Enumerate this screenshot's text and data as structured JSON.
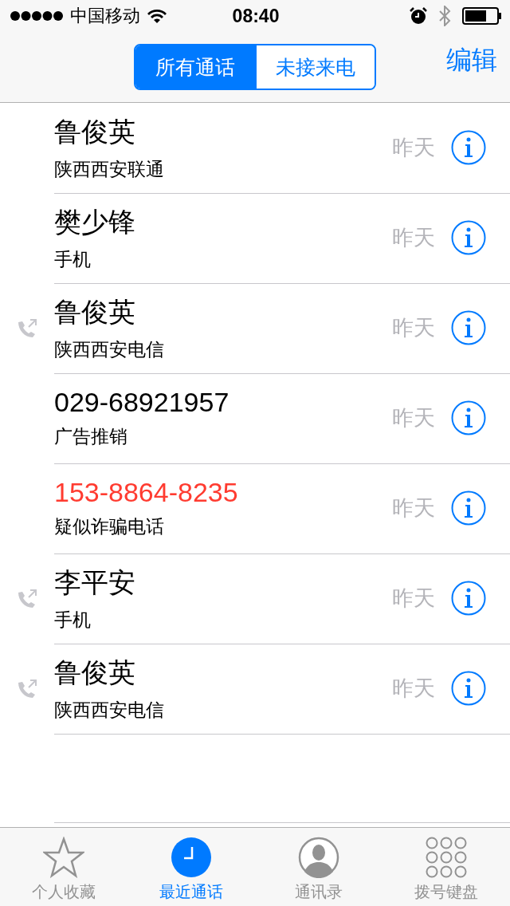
{
  "status_bar": {
    "carrier": "中国移动",
    "time": "08:40"
  },
  "segments": [
    {
      "label": "所有通话",
      "selected": true
    },
    {
      "label": "未接来电",
      "selected": false
    }
  ],
  "edit_button": "编辑",
  "calls": [
    {
      "name": "鲁俊英",
      "detail": "陕西西安联通",
      "time": "昨天",
      "outgoing": false,
      "missed": false
    },
    {
      "name": "樊少锋",
      "detail": "手机",
      "time": "昨天",
      "outgoing": false,
      "missed": false
    },
    {
      "name": "鲁俊英",
      "detail": "陕西西安电信",
      "time": "昨天",
      "outgoing": true,
      "missed": false
    },
    {
      "name": "029-68921957",
      "detail": "广告推销",
      "time": "昨天",
      "outgoing": false,
      "missed": false
    },
    {
      "name": "153-8864-8235",
      "detail": "疑似诈骗电话",
      "time": "昨天",
      "outgoing": false,
      "missed": true
    },
    {
      "name": "李平安",
      "detail": "手机",
      "time": "昨天",
      "outgoing": true,
      "missed": false
    },
    {
      "name": "鲁俊英",
      "detail": "陕西西安电信",
      "time": "昨天",
      "outgoing": true,
      "missed": false
    }
  ],
  "tab_bar": [
    {
      "kind": "favorites",
      "label": "个人收藏",
      "selected": false
    },
    {
      "kind": "recents",
      "label": "最近通话",
      "selected": true
    },
    {
      "kind": "contacts",
      "label": "通讯录",
      "selected": false
    },
    {
      "kind": "keypad",
      "label": "拨号键盘",
      "selected": false
    }
  ]
}
